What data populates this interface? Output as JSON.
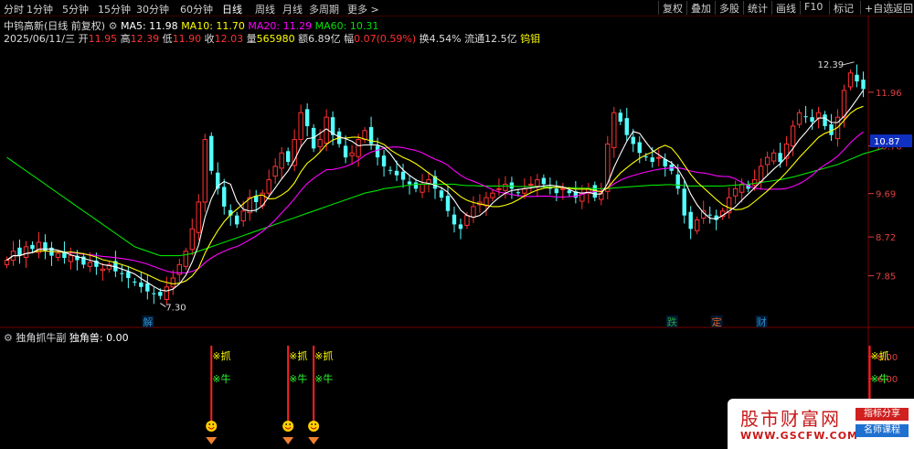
{
  "toolbar": {
    "tabs": [
      "分时",
      "1分钟",
      "5分钟",
      "15分钟",
      "30分钟",
      "60分钟",
      "日线",
      "周线",
      "月线",
      "多周期",
      "更多 >"
    ],
    "active_tab": "日线",
    "right_buttons": [
      "复权",
      "叠加",
      "多股",
      "统计",
      "画线",
      "F10",
      "标记",
      "+自选",
      "返回"
    ]
  },
  "info": {
    "title": "中钨高新(日线 前复权)",
    "ma5": "MA5: 11.98",
    "ma10": "MA10: 11.70",
    "ma20": "MA20: 11.29",
    "ma60": "MA60: 10.31",
    "date": "2025/06/11/三",
    "open_label": "开",
    "open": "11.95",
    "high_label": "高",
    "high": "12.39",
    "low_label": "低",
    "low": "11.90",
    "close_label": "收",
    "close": "12.03",
    "vol_label": "量",
    "vol": "565980",
    "amt_label": "额",
    "amt": "6.89亿",
    "chg_label": "幅",
    "chg": "0.07(0.59%)",
    "turn_label": "换",
    "turn": "4.54%",
    "float_label": "流通",
    "float": "12.5亿",
    "concept": "钨钼"
  },
  "colors": {
    "up": "#ff3232",
    "down": "#54ffff",
    "ma5": "#ffffff",
    "ma10": "#ffff00",
    "ma20": "#ff00ff",
    "ma60": "#00e000",
    "axis": "#e04040"
  },
  "chart_data": {
    "type": "candlestick",
    "y_ticks": [
      7.85,
      8.72,
      9.69,
      10.76,
      11.96
    ],
    "ylim": [
      6.9,
      13.0
    ],
    "current_price": "10.87",
    "max_label": "12.39",
    "min_label": "7.30",
    "markers": [
      "解",
      "跌",
      "定",
      "财"
    ],
    "closes": [
      8.2,
      8.4,
      8.3,
      8.5,
      8.45,
      8.6,
      8.4,
      8.3,
      8.35,
      8.25,
      8.3,
      8.2,
      8.1,
      8.15,
      8.05,
      8.0,
      8.1,
      7.95,
      7.9,
      7.8,
      7.7,
      7.6,
      7.5,
      7.45,
      7.4,
      7.6,
      7.8,
      8.1,
      8.4,
      8.9,
      9.5,
      10.9,
      10.2,
      9.8,
      9.4,
      9.2,
      9.0,
      9.3,
      9.6,
      9.5,
      9.7,
      10.0,
      10.3,
      10.6,
      10.4,
      10.9,
      11.5,
      11.2,
      10.7,
      10.9,
      11.4,
      11.0,
      10.8,
      10.5,
      10.6,
      10.9,
      11.1,
      10.8,
      10.5,
      10.3,
      10.2,
      10.1,
      10.0,
      9.9,
      9.8,
      9.9,
      10.0,
      9.8,
      9.6,
      9.3,
      9.0,
      8.9,
      9.2,
      9.4,
      9.5,
      9.6,
      9.7,
      9.8,
      9.9,
      9.8,
      9.7,
      9.8,
      9.9,
      10.0,
      9.9,
      9.8,
      9.7,
      9.8,
      9.7,
      9.6,
      9.7,
      9.8,
      9.6,
      9.7,
      10.8,
      11.5,
      11.3,
      11.0,
      10.8,
      10.6,
      10.5,
      10.4,
      10.5,
      10.3,
      10.2,
      9.8,
      9.2,
      8.9,
      9.1,
      9.3,
      9.2,
      9.1,
      9.3,
      9.6,
      9.8,
      9.9,
      9.8,
      10.0,
      10.3,
      10.5,
      10.6,
      10.4,
      10.8,
      11.2,
      11.5,
      11.4,
      11.3,
      11.5,
      11.2,
      11.0,
      11.4,
      12.0,
      12.39,
      12.2,
      12.03
    ],
    "ma60": [
      10.5,
      10.4,
      10.3,
      10.2,
      10.1,
      10.0,
      9.9,
      9.8,
      9.7,
      9.6,
      9.5,
      9.4,
      9.3,
      9.2,
      9.1,
      9.0,
      8.9,
      8.8,
      8.7,
      8.6,
      8.5,
      8.45,
      8.4,
      8.35,
      8.3,
      8.3,
      8.3,
      8.3,
      8.32,
      8.35,
      8.4,
      8.45,
      8.5,
      8.55,
      8.6,
      8.65,
      8.7,
      8.75,
      8.8,
      8.85,
      8.9,
      8.95,
      9.0,
      9.05,
      9.1,
      9.15,
      9.2,
      9.25,
      9.3,
      9.35,
      9.4,
      9.45,
      9.5,
      9.55,
      9.6,
      9.65,
      9.7,
      9.73,
      9.76,
      9.8,
      9.82,
      9.84,
      9.86,
      9.88,
      9.9,
      9.9,
      9.9,
      9.9,
      9.9,
      9.9,
      9.9,
      9.88,
      9.87,
      9.87,
      9.86,
      9.86,
      9.86,
      9.86,
      9.86,
      9.86,
      9.85,
      9.85,
      9.85,
      9.85,
      9.84,
      9.84,
      9.83,
      9.83,
      9.82,
      9.82,
      9.81,
      9.81,
      9.8,
      9.8,
      9.8,
      9.82,
      9.83,
      9.84,
      9.85,
      9.86,
      9.87,
      9.88,
      9.88,
      9.89,
      9.89,
      9.88,
      9.87,
      9.86,
      9.86,
      9.86,
      9.86,
      9.86,
      9.86,
      9.87,
      9.88,
      9.89,
      9.9,
      9.92,
      9.94,
      9.96,
      9.98,
      10.0,
      10.03,
      10.06,
      10.1,
      10.14,
      10.18,
      10.22,
      10.26,
      10.3,
      10.34,
      10.4,
      10.46,
      10.52,
      10.58,
      10.62,
      10.66,
      10.7
    ]
  },
  "indicator": {
    "name": "独角抓牛副",
    "value": "独角兽: 0.00",
    "y_ticks": [
      "8.00",
      "6.00",
      "2.00"
    ],
    "signal_catch": "※抓",
    "signal_bull": "※牛"
  },
  "watermark": {
    "title": "股市财富网",
    "url": "WWW.GSCFW.COM",
    "badge1": "指标分享",
    "badge2": "名师课程"
  }
}
